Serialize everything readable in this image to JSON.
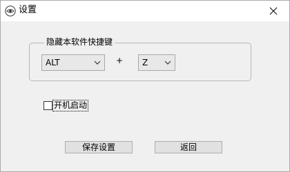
{
  "window": {
    "title": "设置"
  },
  "hotkey": {
    "group_label": "隐藏本软件快捷键",
    "modifier": "ALT",
    "plus": "+",
    "key": "Z"
  },
  "startup": {
    "label": "开机启动",
    "checked": false
  },
  "buttons": {
    "save": "保存设置",
    "back": "返回"
  },
  "icons": {
    "app": "eye-icon",
    "close": "close-icon",
    "dropdown": "chevron-down-icon"
  }
}
